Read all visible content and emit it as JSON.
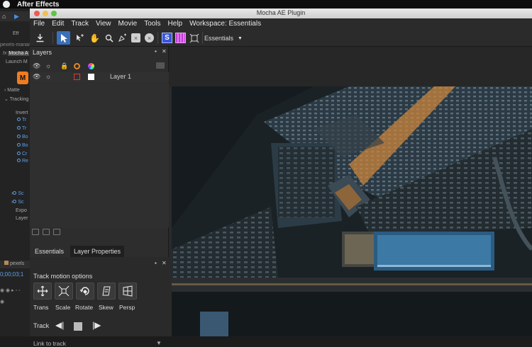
{
  "mac_menu": {
    "app_name": "After Effects"
  },
  "ae_panel": {
    "rows": [
      "Eff",
      "pexels-marian",
      "Mocha A",
      "Launch M",
      "Matte",
      "Tracking",
      "Invert",
      "Tr",
      "Tr",
      "Bo",
      "Bo",
      "Cr",
      "Re",
      "Sc",
      "Sc",
      "Expo",
      "Layer",
      "pexels",
      "0;00;03;1"
    ]
  },
  "window": {
    "title": "Mocha AE Plugin"
  },
  "menu": [
    "File",
    "Edit",
    "Track",
    "View",
    "Movie",
    "Tools",
    "Help",
    "Workspace: Essentials"
  ],
  "toolbar": {
    "icons": [
      "export-icon",
      "select-arrow-icon",
      "add-point-icon",
      "hand-icon",
      "zoom-icon",
      "pen-icon",
      "rectangle-tool-icon",
      "circle-tool-icon",
      "surface-icon",
      "grid-icon",
      "transform-icon"
    ],
    "workspace": "Essentials"
  },
  "layers_panel": {
    "title": "Layers",
    "layer_name": "Layer 1"
  },
  "params": {
    "tabs": [
      "Essentials",
      "Layer Properties"
    ],
    "section": "Track motion options",
    "motion_buttons": [
      {
        "label": "Trans",
        "icon": "translate-icon"
      },
      {
        "label": "Scale",
        "icon": "scale-icon"
      },
      {
        "label": "Rotate",
        "icon": "rotate-icon"
      },
      {
        "label": "Skew",
        "icon": "skew-icon"
      },
      {
        "label": "Persp",
        "icon": "perspective-icon"
      }
    ],
    "track_label": "Track",
    "link_label": "Link to track"
  }
}
